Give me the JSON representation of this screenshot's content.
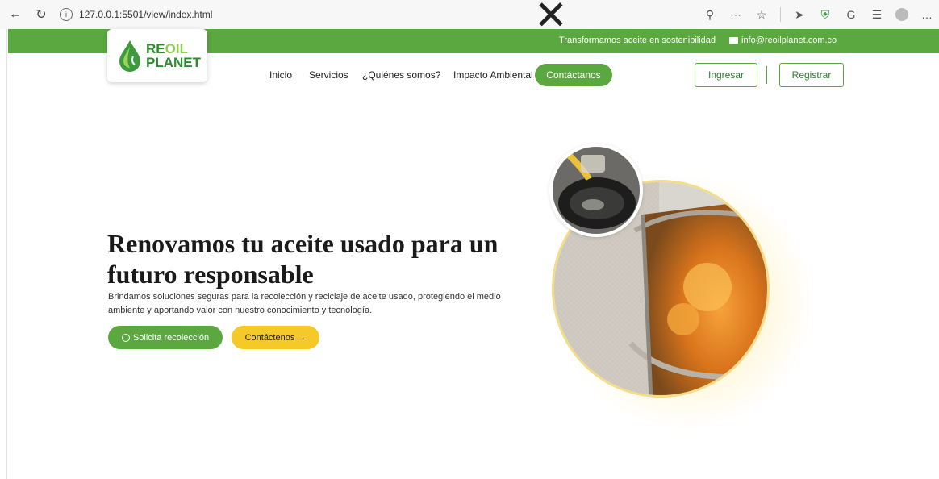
{
  "browser": {
    "url": "127.0.0.1:5501/view/index.html"
  },
  "topbar": {
    "tagline": "Transformamos aceite en sostenibilidad",
    "email": "info@reoilplanet.com.co"
  },
  "logo": {
    "line1_a": "RE",
    "line1_b": "OIL",
    "line2": "PLANET"
  },
  "nav": {
    "items": [
      {
        "label": "Inicio"
      },
      {
        "label": "Servicios"
      },
      {
        "label": "¿Quiénes somos?"
      },
      {
        "label": "Impacto Ambiental"
      }
    ],
    "contact": "Contáctanos",
    "login": "Ingresar",
    "register": "Registrar"
  },
  "hero": {
    "title": "Renovamos tu aceite usado para un futuro responsable",
    "description": "Brindamos soluciones seguras para la recolección y reciclaje de aceite usado, protegiendo el medio ambiente y aportando valor con nuestro conocimiento y tecnología.",
    "cta_primary": "Solicita recolección",
    "cta_secondary": "Contáctenos →"
  },
  "colors": {
    "brand_green": "#5aa83f",
    "accent_yellow": "#f5c927"
  }
}
